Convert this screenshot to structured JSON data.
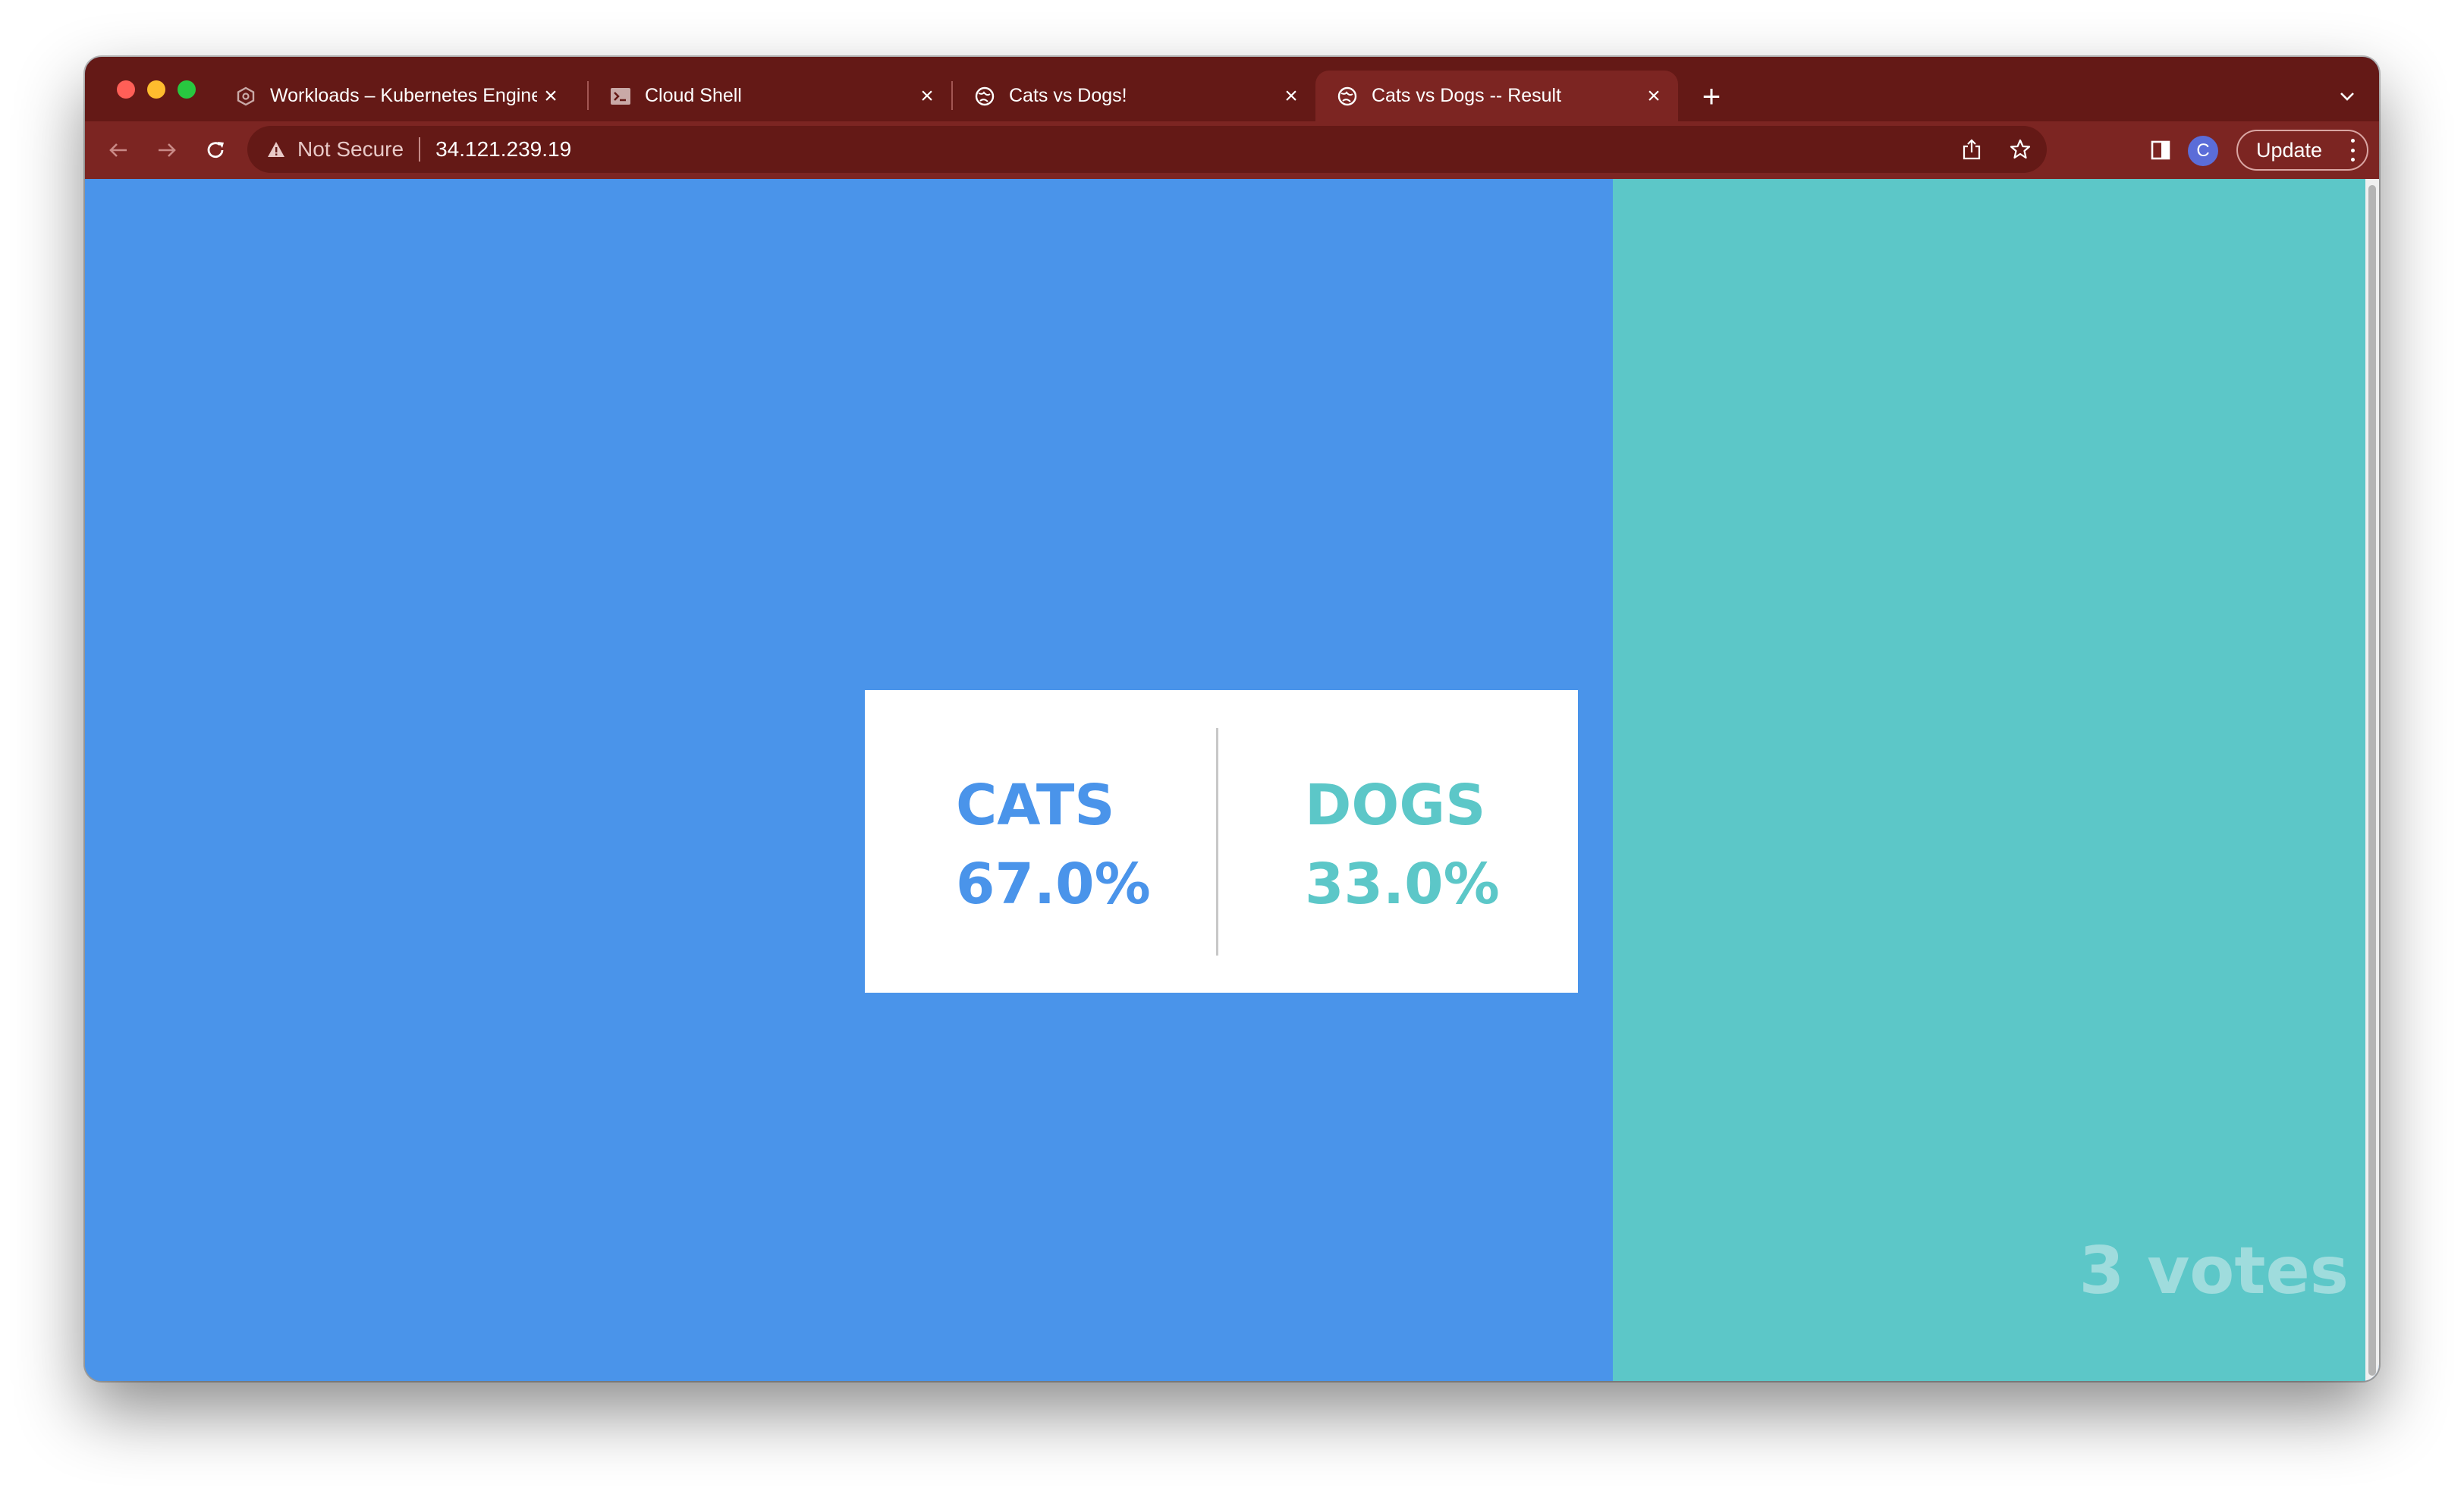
{
  "browser": {
    "tabs": [
      {
        "title": "Workloads – Kubernetes Engine",
        "icon": "kubernetes-icon",
        "active": false
      },
      {
        "title": "Cloud Shell",
        "icon": "terminal-icon",
        "active": false
      },
      {
        "title": "Cats vs Dogs!",
        "icon": "globe-icon",
        "active": false
      },
      {
        "title": "Cats vs Dogs -- Result",
        "icon": "globe-icon",
        "active": true
      }
    ],
    "new_tab_label": "+",
    "security_label": "Not Secure",
    "url": "34.121.239.19",
    "avatar_initial": "C",
    "update_label": "Update",
    "colors": {
      "tabstrip": "#641916",
      "toolbar": "#7c2522"
    }
  },
  "result": {
    "cats": {
      "label": "CATS",
      "percent": "67.0%",
      "share": 0.67
    },
    "dogs": {
      "label": "DOGS",
      "percent": "33.0%",
      "share": 0.33
    },
    "votes_text": "3 votes",
    "colors": {
      "cats": "#4a94ea",
      "dogs": "#5cc7c8"
    }
  }
}
